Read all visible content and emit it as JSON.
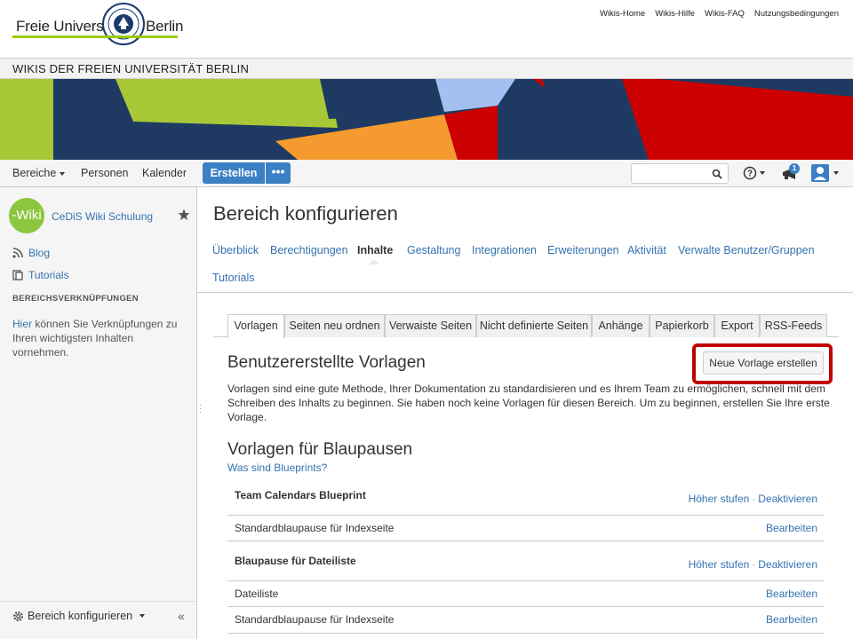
{
  "header": {
    "logo_word_left": "Freie Universität",
    "logo_word_right": "Berlin",
    "top_links": [
      "Wikis-Home",
      "Wikis-Hilfe",
      "Wikis-FAQ",
      "Nutzungsbedingungen"
    ],
    "wiki_band_title": "WIKIS DER FREIEN UNIVERSITÄT BERLIN"
  },
  "navbar": {
    "spaces": "Bereiche",
    "people": "Personen",
    "calendar": "Kalender",
    "create": "Erstellen",
    "more": "•••",
    "notifications_count": "1"
  },
  "sidebar": {
    "logo_text": "-Wiki",
    "space_name": "CeDiS Wiki Schulung",
    "links": [
      "Blog",
      "Tutorials"
    ],
    "heading": "BEREICHSVERKNÜPFUNGEN",
    "help_link": "Hier",
    "help_text": " können Sie Verknüpfungen zu Ihren wichtigsten Inhalten vornehmen.",
    "footer_config": "Bereich konfigurieren",
    "collapse": "«"
  },
  "main": {
    "page_title": "Bereich konfigurieren",
    "config_nav": [
      "Überblick",
      "Berechtigungen",
      "Inhalte",
      "Gestaltung",
      "Integrationen",
      "Erweiterungen",
      "Aktivität",
      "Verwalte Benutzer/Gruppen",
      "Tutorials"
    ],
    "config_nav_active": "Inhalte",
    "tabs": [
      "Vorlagen",
      "Seiten neu ordnen",
      "Verwaiste Seiten",
      "Nicht definierte Seiten",
      "Anhänge",
      "Papierkorb",
      "Export",
      "RSS-Feeds"
    ],
    "tabs_active": "Vorlagen",
    "section1_title": "Benutzererstellte Vorlagen",
    "new_template_button": "Neue Vorlage erstellen",
    "section1_text": "Vorlagen sind eine gute Methode, Ihrer Dokumentation zu standardisieren und es Ihrem Team zu ermöglichen, schnell mit dem Schreiben des Inhalts zu beginnen. Sie haben noch keine Vorlagen für diesen Bereich. Um zu beginnen, erstellen Sie Ihre erste Vorlage.",
    "section2_title": "Vorlagen für Blaupausen",
    "section2_link": "Was sind Blueprints?",
    "blueprints": [
      {
        "name": "Team Calendars Blueprint",
        "bold": true,
        "actions": [
          "Höher stufen",
          "Deaktivieren"
        ]
      },
      {
        "name": "Standardblaupause für Indexseite",
        "bold": false,
        "actions": [
          "Bearbeiten"
        ]
      },
      {
        "name": "Blaupause für Dateiliste",
        "bold": true,
        "actions": [
          "Höher stufen",
          "Deaktivieren"
        ]
      },
      {
        "name": "Dateiliste",
        "bold": false,
        "actions": [
          "Bearbeiten"
        ]
      },
      {
        "name": "Standardblaupause für Indexseite",
        "bold": false,
        "actions": [
          "Bearbeiten"
        ]
      }
    ]
  },
  "colors": {
    "link": "#3572b0",
    "primary_button": "#3b7fc4",
    "highlight_outline": "#c00000",
    "fu_green": "#99cc00"
  }
}
